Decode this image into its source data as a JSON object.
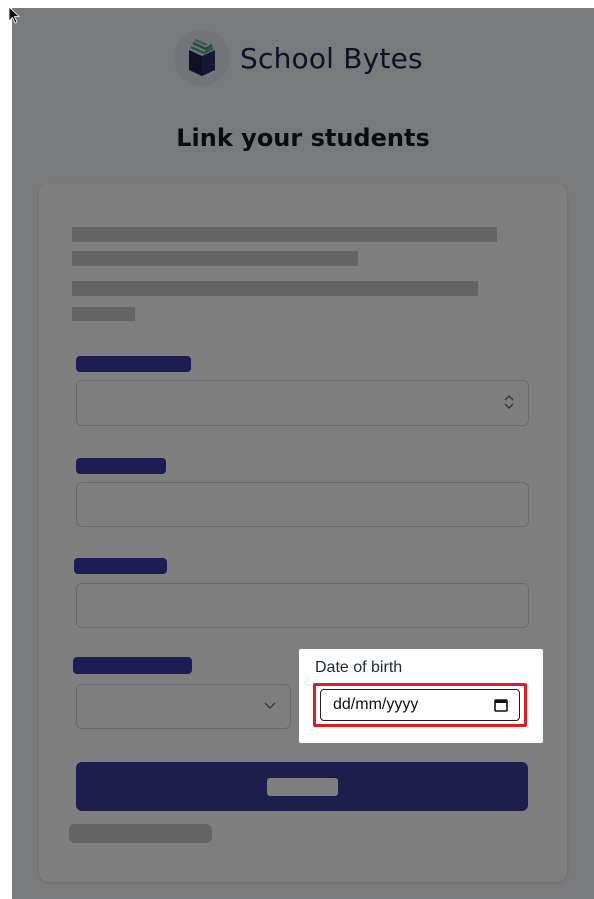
{
  "app": {
    "brand_name": "School Bytes"
  },
  "page": {
    "title": "Link your students"
  },
  "form": {
    "date_of_birth": {
      "label": "Date of birth",
      "placeholder": "dd/mm/yyyy"
    }
  },
  "colors": {
    "brand_navy": "#1f1f4d",
    "button_indigo": "#3d3d99",
    "highlight_red": "#e01b24"
  },
  "icons": {
    "logo": "book-logo-icon",
    "select": "chevron-updown-icon",
    "dropdown": "chevron-down-icon",
    "calendar": "calendar-icon",
    "cursor": "mouse-pointer-icon"
  }
}
